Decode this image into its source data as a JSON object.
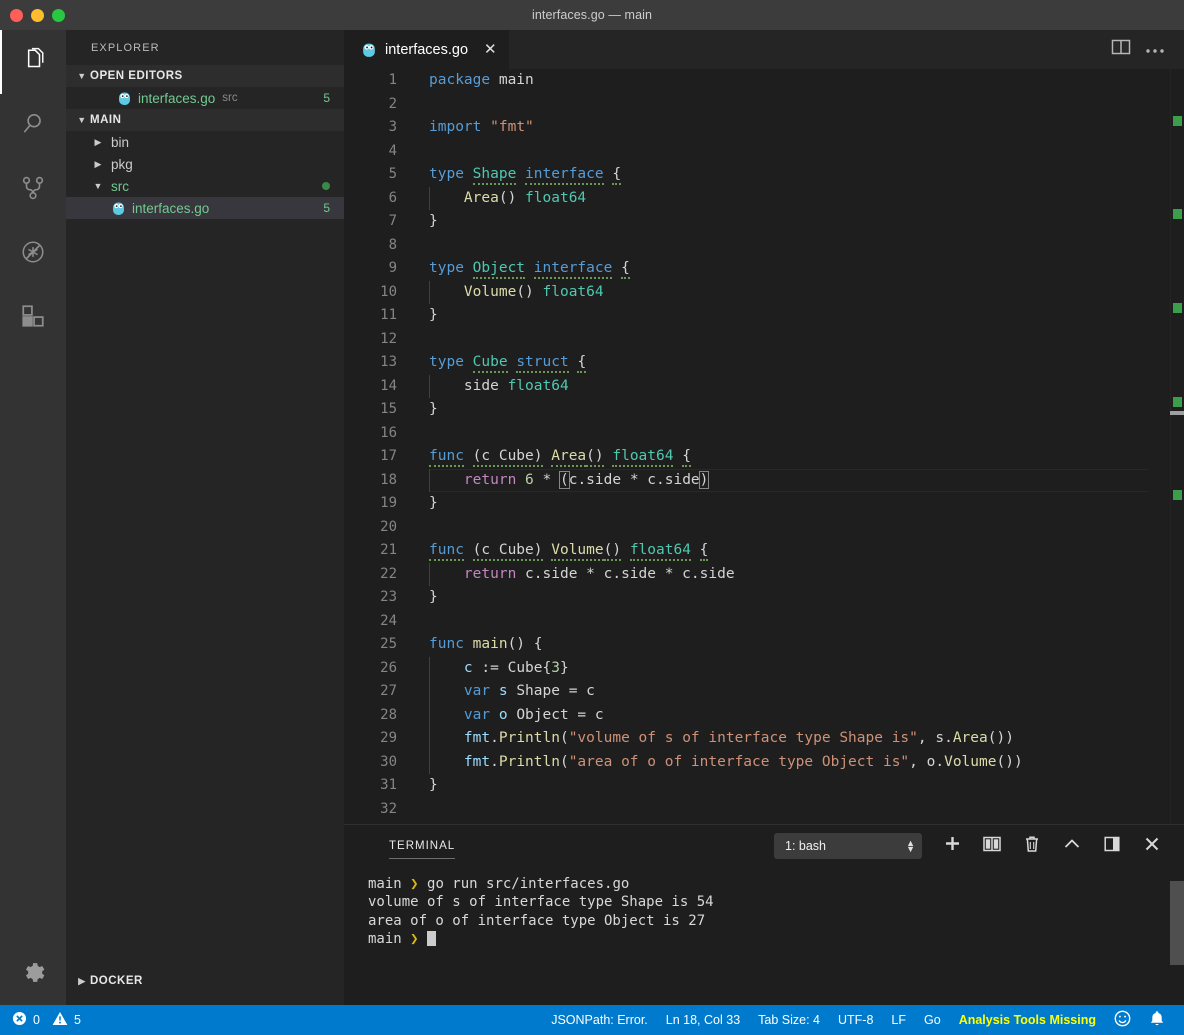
{
  "window": {
    "title": "interfaces.go — main",
    "traffic_lights": [
      "close",
      "minimize",
      "zoom"
    ]
  },
  "activity_bar": {
    "items": [
      {
        "name": "explorer",
        "icon": "files-icon",
        "active": true
      },
      {
        "name": "search",
        "icon": "search-icon",
        "active": false
      },
      {
        "name": "source-control",
        "icon": "source-control-icon",
        "active": false
      },
      {
        "name": "debug",
        "icon": "debug-no-bug-icon",
        "active": false
      },
      {
        "name": "extensions",
        "icon": "extensions-icon",
        "active": false
      }
    ],
    "bottom": {
      "name": "manage",
      "icon": "gear-icon"
    }
  },
  "sidebar": {
    "title": "EXPLORER",
    "open_editors": {
      "label": "OPEN EDITORS",
      "expanded": true,
      "items": [
        {
          "icon": "go-gopher-icon",
          "name": "interfaces.go",
          "folder": "src",
          "badge": "5"
        }
      ]
    },
    "workspace": {
      "label": "MAIN",
      "expanded": true,
      "items": [
        {
          "name": "bin",
          "type": "folder",
          "expanded": false,
          "indent": 1
        },
        {
          "name": "pkg",
          "type": "folder",
          "expanded": false,
          "indent": 1
        },
        {
          "name": "src",
          "type": "folder",
          "expanded": true,
          "indent": 1,
          "marker": "dot"
        },
        {
          "name": "interfaces.go",
          "type": "file",
          "icon": "go-gopher-icon",
          "indent": 2,
          "badge": "5",
          "selected": true
        }
      ]
    },
    "docker": {
      "label": "DOCKER",
      "expanded": false
    }
  },
  "editor": {
    "tab": {
      "label": "interfaces.go",
      "icon": "go-gopher-icon",
      "close": "✕",
      "active": true
    },
    "actions": [
      {
        "name": "split-editor",
        "icon": "split-editor-icon"
      },
      {
        "name": "more-actions",
        "icon": "ellipsis-icon"
      }
    ],
    "language": "Go",
    "lines": [
      {
        "n": 1,
        "text": "package main"
      },
      {
        "n": 2,
        "text": ""
      },
      {
        "n": 3,
        "text": "import \"fmt\""
      },
      {
        "n": 4,
        "text": ""
      },
      {
        "n": 5,
        "text": "type Shape interface {"
      },
      {
        "n": 6,
        "text": "    Area() float64"
      },
      {
        "n": 7,
        "text": "}"
      },
      {
        "n": 8,
        "text": ""
      },
      {
        "n": 9,
        "text": "type Object interface {"
      },
      {
        "n": 10,
        "text": "    Volume() float64"
      },
      {
        "n": 11,
        "text": "}"
      },
      {
        "n": 12,
        "text": ""
      },
      {
        "n": 13,
        "text": "type Cube struct {"
      },
      {
        "n": 14,
        "text": "    side float64"
      },
      {
        "n": 15,
        "text": "}"
      },
      {
        "n": 16,
        "text": ""
      },
      {
        "n": 17,
        "text": "func (c Cube) Area() float64 {"
      },
      {
        "n": 18,
        "text": "    return 6 * (c.side * c.side)"
      },
      {
        "n": 19,
        "text": "}"
      },
      {
        "n": 20,
        "text": ""
      },
      {
        "n": 21,
        "text": "func (c Cube) Volume() float64 {"
      },
      {
        "n": 22,
        "text": "    return c.side * c.side * c.side"
      },
      {
        "n": 23,
        "text": "}"
      },
      {
        "n": 24,
        "text": ""
      },
      {
        "n": 25,
        "text": "func main() {"
      },
      {
        "n": 26,
        "text": "    c := Cube{3}"
      },
      {
        "n": 27,
        "text": "    var s Shape = c"
      },
      {
        "n": 28,
        "text": "    var o Object = c"
      },
      {
        "n": 29,
        "text": "    fmt.Println(\"volume of s of interface type Shape is\", s.Area())"
      },
      {
        "n": 30,
        "text": "    fmt.Println(\"area of o of interface type Object is\", o.Volume())"
      },
      {
        "n": 31,
        "text": "}"
      },
      {
        "n": 32,
        "text": ""
      }
    ],
    "cursor_line": 18,
    "overview_marks": [
      5,
      9,
      13,
      17,
      21
    ]
  },
  "panel": {
    "tab_label": "TERMINAL",
    "terminal_select": {
      "value": "1: bash"
    },
    "actions": [
      {
        "name": "new-terminal",
        "icon": "plus-icon"
      },
      {
        "name": "split-terminal",
        "icon": "split-icon"
      },
      {
        "name": "kill-terminal",
        "icon": "trash-icon"
      },
      {
        "name": "maximize-panel",
        "icon": "chevron-up-icon"
      },
      {
        "name": "toggle-panel-position",
        "icon": "panel-layout-icon"
      },
      {
        "name": "close-panel",
        "icon": "close-icon"
      }
    ],
    "lines": [
      {
        "prompt": "main",
        "arrow": "❯",
        "text": " go run src/interfaces.go"
      },
      {
        "prompt": "",
        "arrow": "",
        "text": "volume of s of interface type Shape is 54"
      },
      {
        "prompt": "",
        "arrow": "",
        "text": "area of o of interface type Object is 27"
      },
      {
        "prompt": "main",
        "arrow": "❯",
        "text": " ",
        "cursor": true
      }
    ]
  },
  "status_bar": {
    "errors": "0",
    "warnings": "5",
    "items": [
      {
        "name": "jsonpath",
        "label": "JSONPath: Error."
      },
      {
        "name": "cursor-position",
        "label": "Ln 18, Col 33"
      },
      {
        "name": "tab-size",
        "label": "Tab Size: 4"
      },
      {
        "name": "encoding",
        "label": "UTF-8"
      },
      {
        "name": "eol",
        "label": "LF"
      },
      {
        "name": "language-mode",
        "label": "Go"
      },
      {
        "name": "analysis-tools",
        "label": "Analysis Tools Missing",
        "warn": true
      }
    ],
    "right_icons": [
      {
        "name": "feedback-smiley-icon",
        "glyph": "☺"
      },
      {
        "name": "notifications-bell-icon",
        "glyph": "🔔"
      }
    ],
    "accent": "#007acc"
  }
}
